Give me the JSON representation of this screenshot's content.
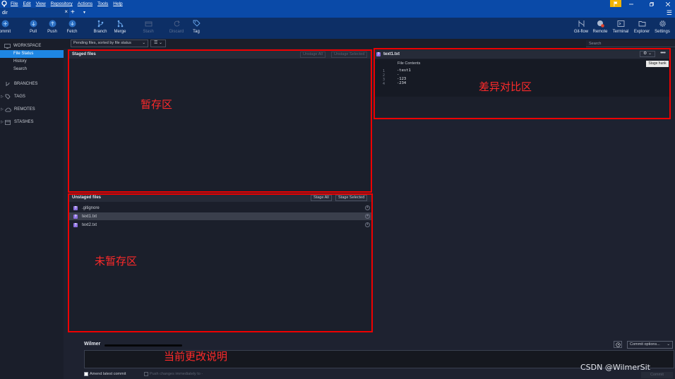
{
  "menubar": {
    "items": [
      "File",
      "Edit",
      "View",
      "Repository",
      "Actions",
      "Tools",
      "Help"
    ]
  },
  "tab": {
    "title": "dir",
    "close": "×",
    "plus": "+",
    "dropdown": "▼"
  },
  "toolbar": {
    "left": [
      {
        "label": "ommit",
        "icon": "commit-icon"
      },
      {
        "label": "Pull",
        "icon": "pull-icon"
      },
      {
        "label": "Push",
        "icon": "push-icon"
      },
      {
        "label": "Fetch",
        "icon": "fetch-icon"
      },
      {
        "label": "Branch",
        "icon": "branch-icon"
      },
      {
        "label": "Merge",
        "icon": "merge-icon"
      },
      {
        "label": "Stash",
        "icon": "stash-icon"
      },
      {
        "label": "Discard",
        "icon": "discard-icon"
      },
      {
        "label": "Tag",
        "icon": "tag-icon"
      }
    ],
    "right": [
      {
        "label": "Git-flow",
        "icon": "git-flow-icon"
      },
      {
        "label": "Remote",
        "icon": "remote-icon"
      },
      {
        "label": "Terminal",
        "icon": "terminal-icon"
      },
      {
        "label": "Explorer",
        "icon": "explorer-icon"
      },
      {
        "label": "Settings",
        "icon": "settings-icon"
      }
    ]
  },
  "sidebar": {
    "workspace": "WORKSPACE",
    "items": [
      "File Status",
      "History",
      "Search"
    ],
    "groups": [
      "BRANCHES",
      "TAGS",
      "REMOTES",
      "STASHES"
    ]
  },
  "filter": {
    "sort": "Pending files, sorted by file status",
    "search_placeholder": "Search"
  },
  "staged": {
    "title": "Staged files",
    "unstage_all": "Unstage All",
    "unstage_selected": "Unstage Selected"
  },
  "unstaged": {
    "title": "Unstaged files",
    "stage_all": "Stage All",
    "stage_selected": "Stage Selected",
    "files": [
      ".gitignore",
      "text1.txt",
      "text2.txt"
    ],
    "status_glyph": "?"
  },
  "diff": {
    "filename": "text1.txt",
    "header": "File Contents",
    "lines": [
      {
        "num": "1",
        "text": "-test1"
      },
      {
        "num": "2",
        "text": "-"
      },
      {
        "num": "3",
        "text": "-123"
      },
      {
        "num": "4",
        "text": "-234"
      }
    ],
    "tooltip": "Stage hunk"
  },
  "annotations": {
    "staged": "暂存区",
    "unstaged": "未暂存区",
    "diff": "差异对比区",
    "commit": "当前更改说明"
  },
  "commit": {
    "author": "Wilmer",
    "options": "Commit options...",
    "amend": "Amend latest commit",
    "push_immediately": "Push changes immediately to -",
    "button": "Commit"
  },
  "watermark": "CSDN @WilmerSit",
  "colors": {
    "accent": "#1e86e3",
    "menubar": "#0a4aa8",
    "annotation": "#ff2a2a",
    "status_untracked": "#8a6ee0"
  }
}
